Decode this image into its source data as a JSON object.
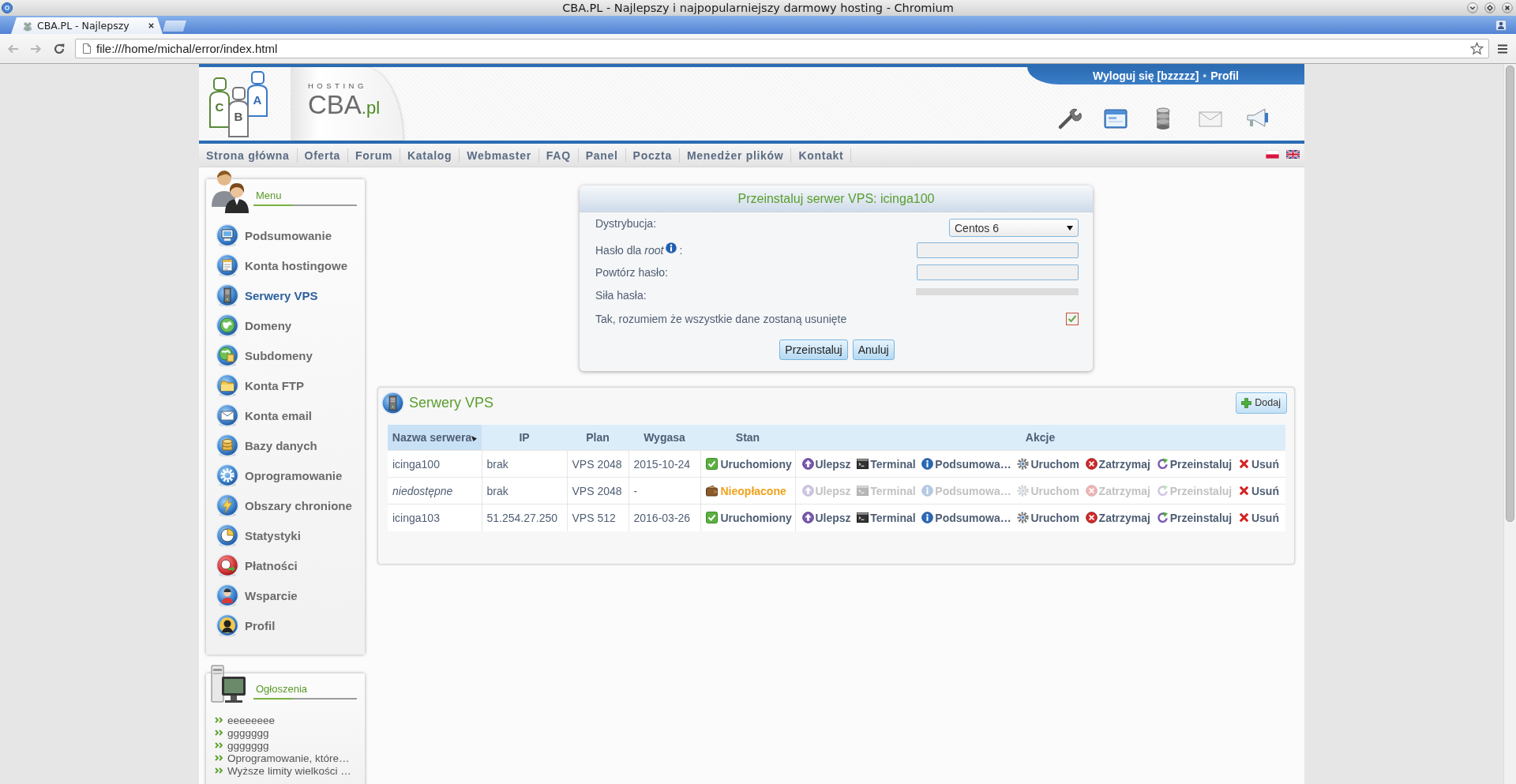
{
  "window": {
    "title": "CBA.PL - Najlepszy i najpopularniejszy darmowy hosting - Chromium"
  },
  "tabs": [
    {
      "label": "CBA.PL - Najlepszy",
      "selected": true
    }
  ],
  "address_bar": {
    "value": "file:///home/michal/error/index.html"
  },
  "header": {
    "logo": {
      "figures": [
        "C",
        "B",
        "A"
      ],
      "tagline": "HOSTING",
      "name": "CBA",
      "suffix": ".pl"
    },
    "user_links": [
      "Wyloguj się [bzzzzz]",
      "Profil"
    ],
    "separator": "•"
  },
  "nav": {
    "items": [
      "Strona główna",
      "Oferta",
      "Forum",
      "Katalog",
      "Webmaster",
      "FAQ",
      "Panel",
      "Poczta",
      "Menedżer plików",
      "Kontakt"
    ]
  },
  "sidebar": {
    "menu": {
      "title": "Menu",
      "items": [
        {
          "label": "Podsumowanie",
          "selected": false
        },
        {
          "label": "Konta hostingowe",
          "selected": false
        },
        {
          "label": "Serwery VPS",
          "selected": true
        },
        {
          "label": "Domeny",
          "selected": false
        },
        {
          "label": "Subdomeny",
          "selected": false
        },
        {
          "label": "Konta FTP",
          "selected": false
        },
        {
          "label": "Konta email",
          "selected": false
        },
        {
          "label": "Bazy danych",
          "selected": false
        },
        {
          "label": "Oprogramowanie",
          "selected": false
        },
        {
          "label": "Obszary chronione",
          "selected": false
        },
        {
          "label": "Statystyki",
          "selected": false
        },
        {
          "label": "Płatności",
          "selected": false
        },
        {
          "label": "Wsparcie",
          "selected": false
        },
        {
          "label": "Profil",
          "selected": false
        }
      ]
    },
    "announcements": {
      "title": "Ogłoszenia",
      "items": [
        "eeeeeeee",
        "ggggggg",
        "ggggggg",
        "Oprogramowanie, które…",
        "Wyższe limity wielkości …"
      ]
    }
  },
  "reinstall_dialog": {
    "title": "Przeinstaluj serwer VPS: icinga100",
    "fields": [
      {
        "kind": "select",
        "label": "Dystrybucja:",
        "value": "Centos 6"
      },
      {
        "kind": "password",
        "label": "Hasło dla *root*",
        "info": true,
        "label_end": ":"
      },
      {
        "kind": "password",
        "label": "Powtórz hasło:",
        "info": false
      },
      {
        "kind": "meter",
        "label": "Siła hasła:"
      },
      {
        "kind": "checkbox",
        "label": "Tak, rozumiem że wszystkie dane zostaną usunięte",
        "checked": true
      }
    ],
    "buttons": [
      "Przeinstaluj",
      "Anuluj"
    ]
  },
  "vps_panel": {
    "title": "Serwery VPS",
    "add_button": "Dodaj",
    "table": {
      "columns": [
        {
          "label": "Nazwa serwera",
          "sorted": true
        },
        {
          "label": "IP",
          "sorted": false
        },
        {
          "label": "Plan",
          "sorted": false
        },
        {
          "label": "Wygasa",
          "sorted": false
        },
        {
          "label": "Stan",
          "sorted": false
        },
        {
          "label": "Akcje",
          "sorted": false
        }
      ],
      "rows": [
        {
          "name": "icinga100",
          "name_set": true,
          "ip": "brak",
          "plan": "VPS 2048",
          "expires": "2015-10-24",
          "status": {
            "kind": "running",
            "label": "Uruchomiony"
          },
          "actions": [
            {
              "kind": "upgrade",
              "label": "Ulepsz",
              "disabled": false
            },
            {
              "kind": "terminal",
              "label": "Terminal",
              "disabled": false
            },
            {
              "kind": "summary",
              "label": "Podsumowa…",
              "disabled": false
            },
            {
              "kind": "start",
              "label": "Uruchom",
              "disabled": false
            },
            {
              "kind": "stop",
              "label": "Zatrzymaj",
              "disabled": false
            },
            {
              "kind": "reinstall",
              "label": "Przeinstaluj",
              "disabled": false
            },
            {
              "kind": "delete",
              "label": "Usuń",
              "disabled": false
            }
          ]
        },
        {
          "name": "niedostępne",
          "name_set": false,
          "ip": "brak",
          "plan": "VPS 2048",
          "expires": "-",
          "status": {
            "kind": "unpaid",
            "label": "Nieopłacone"
          },
          "actions": [
            {
              "kind": "upgrade",
              "label": "Ulepsz",
              "disabled": true
            },
            {
              "kind": "terminal",
              "label": "Terminal",
              "disabled": true
            },
            {
              "kind": "summary",
              "label": "Podsumowa…",
              "disabled": true
            },
            {
              "kind": "start",
              "label": "Uruchom",
              "disabled": true
            },
            {
              "kind": "stop",
              "label": "Zatrzymaj",
              "disabled": true
            },
            {
              "kind": "reinstall",
              "label": "Przeinstaluj",
              "disabled": true
            },
            {
              "kind": "delete",
              "label": "Usuń",
              "disabled": false
            }
          ]
        },
        {
          "name": "icinga103",
          "name_set": true,
          "ip": "51.254.27.250",
          "plan": "VPS 512",
          "expires": "2016-03-26",
          "status": {
            "kind": "running",
            "label": "Uruchomiony"
          },
          "actions": [
            {
              "kind": "upgrade",
              "label": "Ulepsz",
              "disabled": false
            },
            {
              "kind": "terminal",
              "label": "Terminal",
              "disabled": false
            },
            {
              "kind": "summary",
              "label": "Podsumowa…",
              "disabled": false
            },
            {
              "kind": "start",
              "label": "Uruchom",
              "disabled": false
            },
            {
              "kind": "stop",
              "label": "Zatrzymaj",
              "disabled": false
            },
            {
              "kind": "reinstall",
              "label": "Przeinstaluj",
              "disabled": false
            },
            {
              "kind": "delete",
              "label": "Usuń",
              "disabled": false
            }
          ]
        }
      ]
    }
  }
}
